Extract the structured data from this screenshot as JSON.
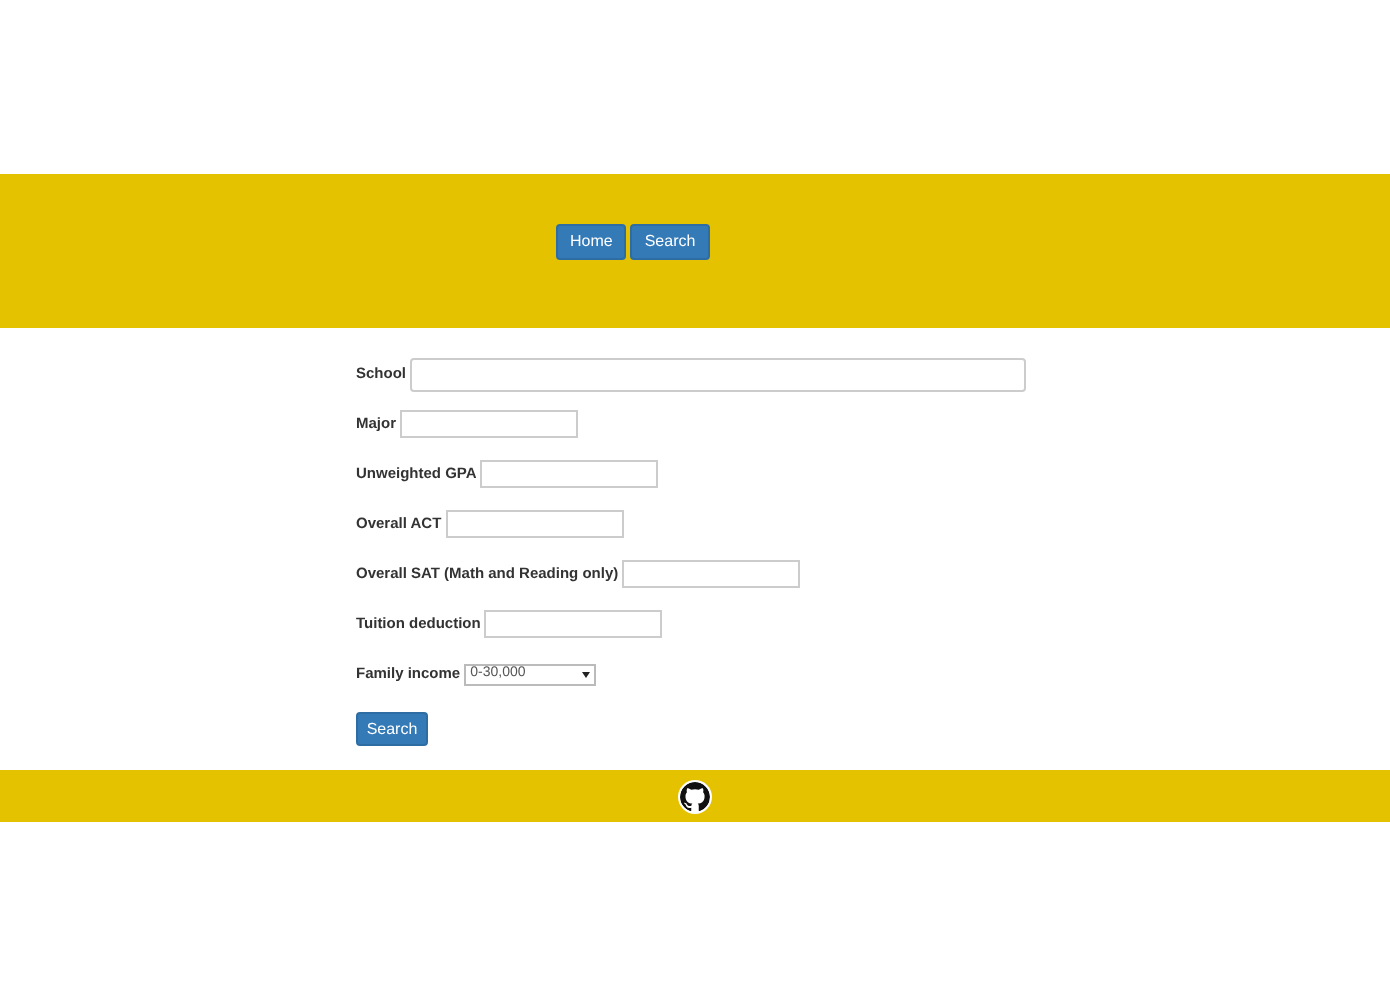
{
  "nav": {
    "buttons": [
      "Home",
      "Search"
    ]
  },
  "form": {
    "fields": [
      {
        "kind": "wide",
        "label": "School"
      },
      {
        "kind": "short",
        "label": "Major"
      },
      {
        "kind": "short",
        "label": "Unweighted GPA"
      },
      {
        "kind": "short",
        "label": "Overall ACT"
      },
      {
        "kind": "short",
        "label": "Overall SAT (Math and Reading only)"
      },
      {
        "kind": "short",
        "label": "Tuition deduction"
      },
      {
        "kind": "select",
        "label": "Family income",
        "value": "0-30,000"
      }
    ],
    "submit": "Search"
  }
}
